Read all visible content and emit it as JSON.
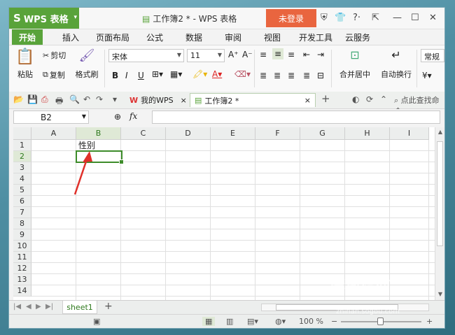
{
  "app": {
    "name": "WPS 表格",
    "logo_glyph": "S",
    "caret": "▾",
    "brand_color": "#59a33a"
  },
  "window": {
    "title": "工作簿2 * - WPS 表格",
    "login_label": "未登录",
    "login_color": "#e9653f"
  },
  "title_icons": [
    "shield-icon",
    "shirt-icon",
    "help-icon",
    "pin-icon",
    "minimize-icon",
    "maximize-icon",
    "close-icon"
  ],
  "title_glyphs": {
    "shield": "⛨",
    "shirt": "👕",
    "help": "?·",
    "pin": "⇱",
    "minimize": "—",
    "maximize": "☐",
    "close": "✕"
  },
  "menu": {
    "tabs": [
      "开始",
      "插入",
      "页面布局",
      "公式",
      "数据",
      "审阅",
      "视图",
      "开发工具",
      "云服务"
    ],
    "active": "开始"
  },
  "ribbon": {
    "paste": "粘贴",
    "cut": "剪切",
    "copy": "复制",
    "format_painter": "格式刷",
    "font_name": "宋体",
    "font_size": "11",
    "bold": "B",
    "italic": "I",
    "underline": "U",
    "increase_font": "A⁺",
    "decrease_font": "A⁻",
    "merge_center": "合并居中",
    "wrap_text": "自动换行",
    "number_format": "常规"
  },
  "quickbar": {
    "tabs": [
      {
        "label": "我的WPS",
        "icon": "W",
        "close": "×"
      },
      {
        "label": "工作簿2 *",
        "icon": "▤",
        "close": "×"
      }
    ],
    "add_tab": "+",
    "search_label": "点此查找命令"
  },
  "formula_bar": {
    "cell_ref": "B2",
    "fx": "fx",
    "formula": ""
  },
  "grid": {
    "columns": [
      "A",
      "B",
      "C",
      "D",
      "E",
      "F",
      "G",
      "H",
      "I"
    ],
    "rows": [
      "1",
      "2",
      "3",
      "4",
      "5",
      "6",
      "7",
      "8",
      "9",
      "10",
      "11",
      "12",
      "13",
      "14"
    ],
    "selected_column": "B",
    "selected_row": "2",
    "cells": {
      "B1": "性别"
    }
  },
  "sheets": {
    "tabs": [
      "sheet1"
    ],
    "active": "sheet1",
    "add": "+"
  },
  "status": {
    "zoom": "100 %",
    "zoom_minus": "−",
    "zoom_plus": "+"
  },
  "watermark": {
    "text": "搜狗指南",
    "url": "zhinan.sogou.com"
  },
  "annotation_color": "#e0302a"
}
